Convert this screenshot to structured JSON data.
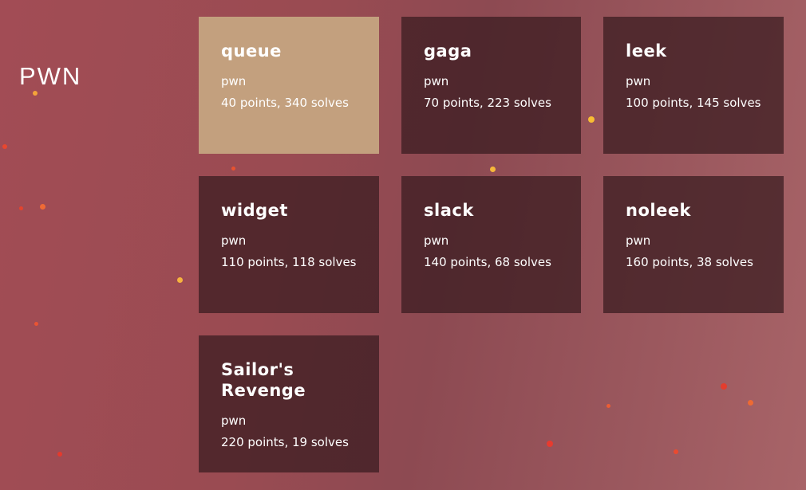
{
  "page": {
    "category_title": "PWN",
    "background_colors": [
      "#a24c55",
      "#8d4a52",
      "#a86468"
    ],
    "card_color": "#3f2226",
    "solved_card_color": "#c3a07e"
  },
  "challenges": [
    {
      "name": "queue",
      "category": "pwn",
      "stats": "40 points, 340 solves",
      "solved": true
    },
    {
      "name": "gaga",
      "category": "pwn",
      "stats": "70 points, 223 solves",
      "solved": false
    },
    {
      "name": "leek",
      "category": "pwn",
      "stats": "100 points, 145 solves",
      "solved": false
    },
    {
      "name": "widget",
      "category": "pwn",
      "stats": "110 points, 118 solves",
      "solved": false
    },
    {
      "name": "slack",
      "category": "pwn",
      "stats": "140 points, 68 solves",
      "solved": false
    },
    {
      "name": "noleek",
      "category": "pwn",
      "stats": "160 points, 38 solves",
      "solved": false
    },
    {
      "name": "Sailor's Revenge",
      "category": "pwn",
      "stats": "220 points, 19 solves",
      "solved": false
    }
  ]
}
